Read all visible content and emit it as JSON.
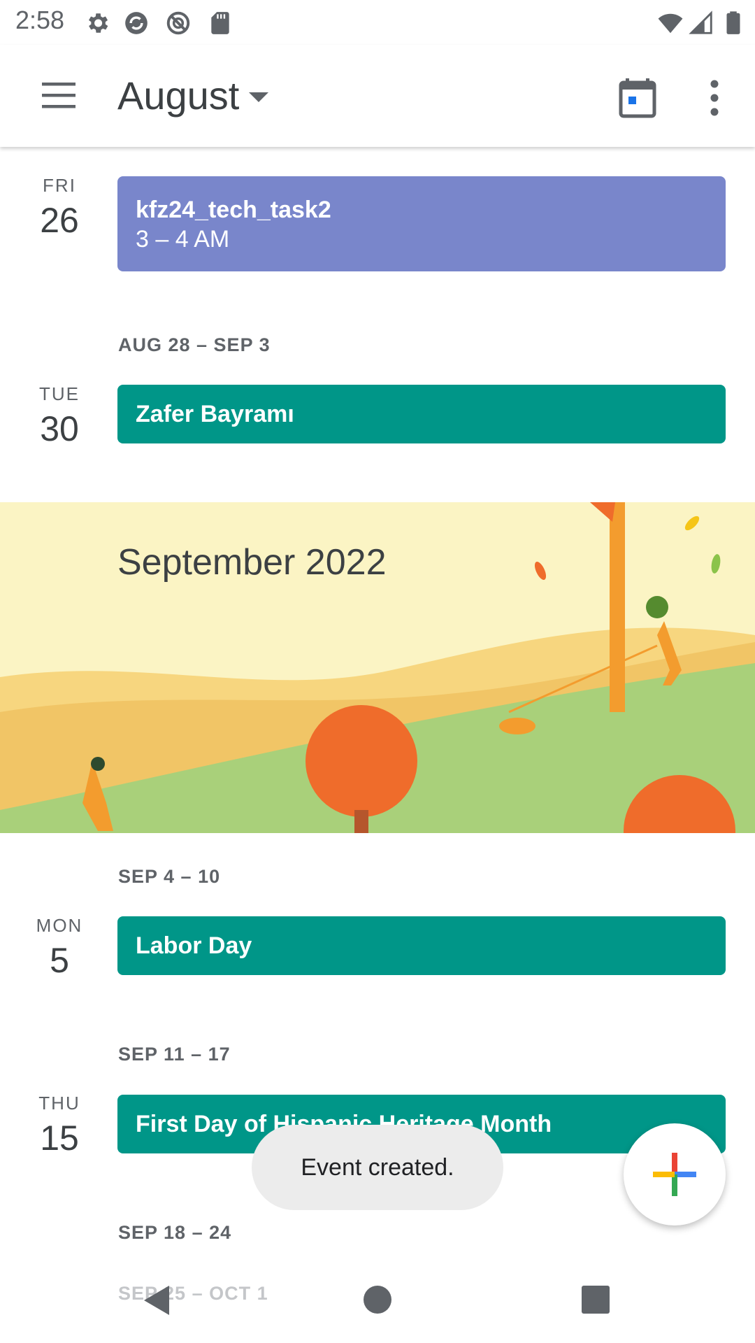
{
  "status_bar": {
    "time": "2:58",
    "icons": [
      "settings-icon",
      "sync-icon",
      "no-signal-app-icon",
      "sd-card-icon",
      "wifi-icon",
      "cell-signal-icon",
      "battery-icon"
    ]
  },
  "app_bar": {
    "month_title": "August",
    "icons": [
      "menu-icon",
      "dropdown-caret-icon",
      "today-calendar-icon",
      "more-vert-icon"
    ]
  },
  "schedule": {
    "day1": {
      "weekday": "FRI",
      "date": "26",
      "event_title": "kfz24_tech_task2",
      "event_time": "3 – 4 AM",
      "event_color": "#7986cb"
    },
    "week1": "AUG 28 – SEP 3",
    "day2": {
      "weekday": "TUE",
      "date": "30",
      "event_title": "Zafer Bayramı",
      "event_color": "#009688"
    },
    "banner_title": "September 2022",
    "week2": "SEP 4 – 10",
    "day3": {
      "weekday": "MON",
      "date": "5",
      "event_title": "Labor Day"
    },
    "week3": "SEP 11 – 17",
    "day4": {
      "weekday": "THU",
      "date": "15",
      "event_title": "First Day of Hispanic Heritage Month"
    },
    "week4": "SEP 18 – 24",
    "week5": "SEP 25 – OCT 1"
  },
  "toast": {
    "message": "Event created."
  },
  "fab": {
    "icon": "plus-multicolor-icon"
  },
  "nav_bar": {
    "icons": [
      "back-icon",
      "home-icon",
      "recents-icon"
    ]
  }
}
